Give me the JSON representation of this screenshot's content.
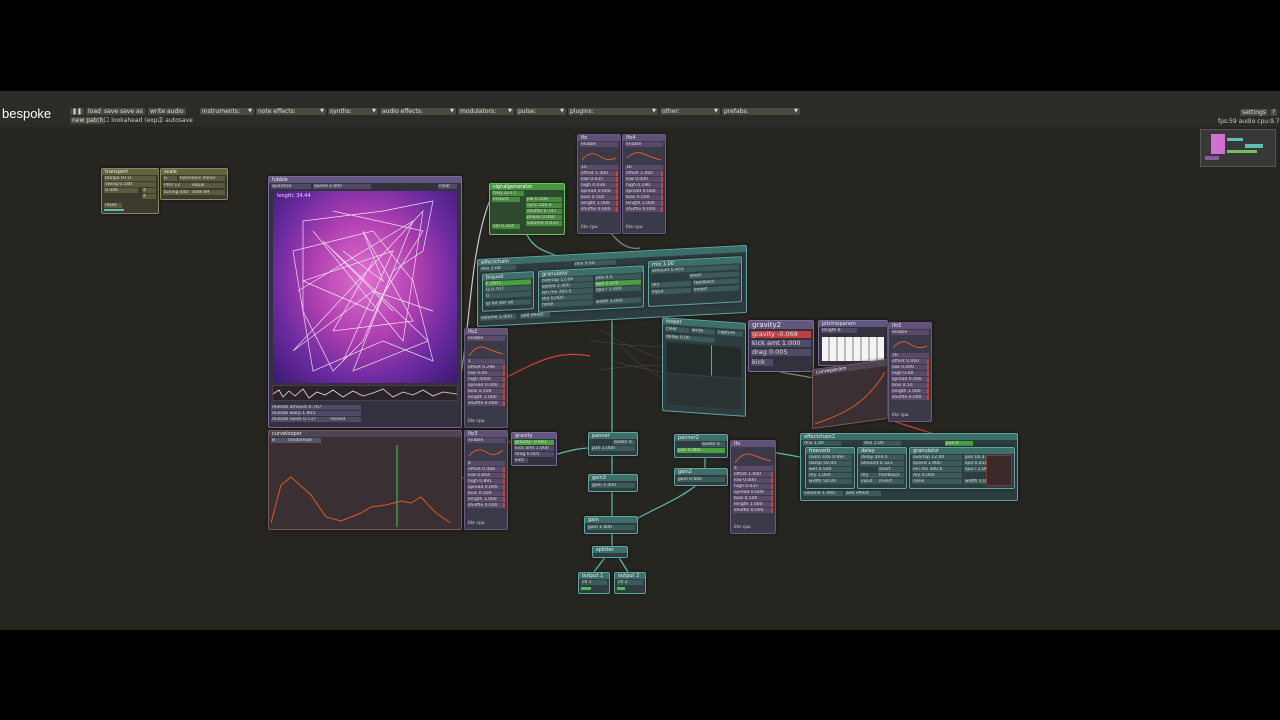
{
  "app": {
    "logo": "bespoke",
    "buttons": {
      "pause": "❚❚",
      "load": "load",
      "save": "save",
      "save_as": "save as",
      "write_audio": "write audio",
      "new_patch": "new patch"
    },
    "checkboxes": {
      "lookahead": "lookahead (exp.)",
      "autosave": "autosave"
    },
    "menus": [
      "instruments:",
      "note effects:",
      "synths:",
      "audio effects:",
      "modulators:",
      "pulse:",
      "plugins:",
      "other:",
      "prefabs:"
    ],
    "settings": "settings",
    "help": "?",
    "status": "fps:59  audio cpu:9.7",
    "colors": {
      "background": "#262520",
      "topbar": "#2c2b27",
      "cable_teal": "#5fbfb5",
      "cable_red": "#d0403a",
      "cable_gray": "#8a8a8a"
    }
  },
  "modules": {
    "transport": {
      "title": "transport",
      "tempo": "tempo 97.0",
      "swing": "swing 0.500",
      "val": "0.346",
      "r1": "4",
      "r2": "4",
      "reset": "reset"
    },
    "scale": {
      "title": "scale",
      "root": "G",
      "mode": "harmonic minor",
      "pitch": "PPO 12",
      "equal": "equal",
      "tuning": "tuning 440",
      "note": "note 69"
    },
    "fubble": {
      "title": "fubble",
      "quantize": "quantize",
      "speed": "speed 1.000",
      "clear": "clear",
      "length": "length: 34.44",
      "mutate_amount": "mutate amount 0.707",
      "mutate_warp": "mutate warp 1.805",
      "mutate_noise": "mutate noise 0.737",
      "reseed": "reseed"
    },
    "curvelooper": {
      "title": "curvelooper",
      "length": "8",
      "randomize": "randomize"
    },
    "lfo1": {
      "title": "lfo",
      "enable": "enable",
      "rows": [
        "1n",
        "offset 1.000",
        "low 0.035",
        "high 0.038",
        "spread 0.000",
        "bias 0.500",
        "length 1.000",
        "shuffle 0.000"
      ],
      "lite": "lite cpu"
    },
    "lfo4": {
      "title": "lfo4",
      "enable": "enable",
      "rows": [
        "16",
        "offset 1.000",
        "low 0.000",
        "high 0.190",
        "spread 0.000",
        "bias 0.500",
        "length 1.000",
        "shuffle 0.000"
      ],
      "lite": "lite cpu"
    },
    "lfo2": {
      "title": "lfo2",
      "enable": "enable",
      "rows": [
        "1",
        "offset 0.296",
        "low 0.09",
        "high 4000",
        "spread 0.000",
        "bias 0.500",
        "length 1.000",
        "shuffle 0.000"
      ],
      "lite": "lite cpu"
    },
    "lfo3": {
      "title": "lfo3",
      "enable": "enable",
      "rows": [
        "4",
        "offset 0.468",
        "low 0.844",
        "high 0.891",
        "spread 0.000",
        "bias 0.500",
        "length 1.000",
        "shuffle 0.000"
      ],
      "lite": "lite cpu"
    },
    "lfo5": {
      "title": "lfo5",
      "enable": "enable",
      "rows": [
        "16",
        "offset 0.000",
        "low 0.000",
        "high 0.08",
        "spread 0.000",
        "bias 0.50",
        "length 1.000",
        "shuffle 0.000"
      ],
      "lite": "lite cpu"
    },
    "lfo6": {
      "title": "lfo",
      "rows": [
        "4",
        "offset 1.000",
        "low 0.000",
        "high 0.637",
        "spread 0.000",
        "bias 0.500",
        "length 1.000",
        "shuffle 0.000"
      ],
      "lite": "lite cpu"
    },
    "signalgenerator": {
      "title": "signalgenerator",
      "freq": "freq 323.1",
      "instant": "instant",
      "pw": "pw 0.500",
      "sync": "sync 200.0",
      "shuffle": "shuffle 0.747",
      "phase": "phase 0.000",
      "volume": "volume 0.033",
      "vol": "vol 0.354"
    },
    "effectchain": {
      "title": "effectchain",
      "mix": "mix 1.00",
      "mix2": "mix 0.50",
      "biquad": "biquad",
      "f": "F 2871",
      "q": "Q 0.707",
      "g": "G",
      "lp": "lp for per all",
      "granulator": "granulator",
      "overlap": "overlap 12.00",
      "speed": "speed 1.000",
      "len": "len ms 300.0",
      "dry": "dry 0.000",
      "none": "none",
      "pos": "pos 0.0",
      "spd": "spd 0.370",
      "spa": "spa r 1.000",
      "width": "width 1.000",
      "volume": "volume 1.000",
      "add": "add effect"
    },
    "delay_top": {
      "title": "mix 1.00",
      "amount": "amount 0.455",
      "short": "short",
      "dry": "dry",
      "feedback": "feedback",
      "input": "input",
      "invert": "invert"
    },
    "looper": {
      "title": "looper",
      "clear": "clear",
      "write": "write",
      "capture": "capture",
      "delay": "delay 0.00"
    },
    "gravity2": {
      "title": "gravity2",
      "gravity": "gravity -0.068",
      "kick": "kick amt 1.000",
      "drag": "drag 0.005",
      "kick_btn": "kick"
    },
    "pitchchain": {
      "title": "pitchtoparam",
      "length": "length 8"
    },
    "curveparam": {
      "title": "curveparam"
    },
    "gravity": {
      "title": "gravity",
      "gravity": "gravity -0.681",
      "kick": "kick amt 1.000",
      "drag": "drag 0.005",
      "kick_btn": "kick"
    },
    "panner": {
      "title": "panner",
      "pan": "pan 1.000",
      "widen": "widen 0"
    },
    "panner2": {
      "title": "panner2",
      "pan": "pan 0.866",
      "widen": "widen 0"
    },
    "gain3": {
      "title": "gain3",
      "gain": "gain 1.000"
    },
    "gain2": {
      "title": "gain2",
      "gain": "gain 0.600"
    },
    "gain": {
      "title": "gain",
      "gain": "gain 1.000"
    },
    "splitter": {
      "title": "splitter"
    },
    "output1": {
      "title": "output 1",
      "ch": "ch 1"
    },
    "output2": {
      "title": "output 2",
      "ch": "ch 2"
    },
    "effectchain2": {
      "title": "effectchain2",
      "mix": "mix 1.00",
      "mix2": "mix 1.00",
      "freeverb": "freeverb",
      "room": "room size 0.997",
      "damp": "damp 50.00",
      "wet": "wet 0.500",
      "dry": "dry 1.000",
      "width": "width 50.00",
      "delay": "delay",
      "delay_ms": "delay 4n4.0",
      "amount": "amount 0.321",
      "short": "short",
      "dry2": "dry",
      "feedback": "feedback",
      "input": "input",
      "invert": "invert",
      "granulator": "granulator",
      "overlap": "overlap 12.00",
      "speed": "speed 1.000",
      "len": "len ms 300.0",
      "dry3": "dry 0.000",
      "none": "none",
      "pos": "pos 16.3",
      "spd": "spd 0.018",
      "spa": "spa r 1.000",
      "width2": "width 1.000",
      "posval": "pos 0",
      "volume": "volume 1.000",
      "add": "add effect"
    }
  }
}
